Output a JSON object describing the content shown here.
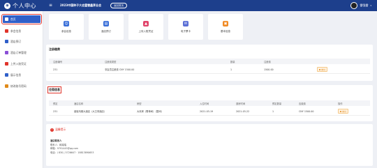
{
  "header": {
    "logo_glyph": "◉",
    "app_title": "个人中心",
    "event_name": "2023中国种子大会暨雪鑫茅业会",
    "back_button": "返回首页",
    "username": "雷强雷"
  },
  "sidebar": {
    "items": [
      {
        "label": "首页",
        "icon": "home-icon",
        "color": "#2f5fc9",
        "active": true
      },
      {
        "label": "参会信息",
        "icon": "user-icon",
        "color": "#e0342b"
      },
      {
        "label": "酒店预订",
        "icon": "hotel-icon",
        "color": "#2f5fc9"
      },
      {
        "label": "酒店订单管理",
        "icon": "order-icon",
        "color": "#8a4fd6"
      },
      {
        "label": "上传入账凭证",
        "icon": "upload-icon",
        "color": "#e0342b"
      },
      {
        "label": "展示信息",
        "icon": "display-icon",
        "color": "#2f5fc9"
      },
      {
        "label": "修改账号密码",
        "icon": "lock-icon",
        "color": "#e08a1a"
      }
    ]
  },
  "quick_actions": [
    {
      "label": "参会信息",
      "icon": "user-icon",
      "color": "#3a6fd8",
      "glyph": "☺"
    },
    {
      "label": "酒店预订",
      "icon": "hotel-icon",
      "color": "#3a6fd8",
      "glyph": "▤"
    },
    {
      "label": "上传入账凭证",
      "icon": "upload-icon",
      "color": "#e0436a",
      "glyph": "▲"
    },
    {
      "label": "电子票卡",
      "icon": "ticket-icon",
      "color": "#5b6fd6",
      "glyph": "✉"
    },
    {
      "label": "基本信息",
      "icon": "info-icon",
      "color": "#f08a24",
      "glyph": "▣"
    }
  ],
  "registration": {
    "title": "注册缴费",
    "columns": [
      "注册编号",
      "注册费类型",
      "数量",
      "注册费",
      ""
    ],
    "rows": [
      {
        "id": "231",
        "type": "非会员注册费 CNY 1500.00",
        "qty": "1",
        "fee": "1500.00",
        "status": "未付"
      }
    ]
  },
  "hotel": {
    "title": "住宿信息",
    "columns": [
      "预定",
      "酒店名称",
      "房型",
      "入住时间",
      "退房时间",
      "预定数量",
      "应缴费",
      "操作"
    ],
    "rows": [
      {
        "id": "231",
        "hotel": "鼎裕鸿雅大酒店（大王府酒店）",
        "room": "大床房（需单间）（整间）",
        "checkin": "2021-03-19",
        "checkout": "2021-03-22",
        "count": "1",
        "fee": "CNY 1500.00",
        "status": "未付"
      }
    ]
  },
  "notice": {
    "text": "温馨提示"
  },
  "contact": {
    "heading": "酒店联系人",
    "name": "联系人：韩瑞瑞",
    "email": "邮箱：9791445@qq.com",
    "phone": "电话：/ 830 | 5726647 · 18813890653"
  }
}
